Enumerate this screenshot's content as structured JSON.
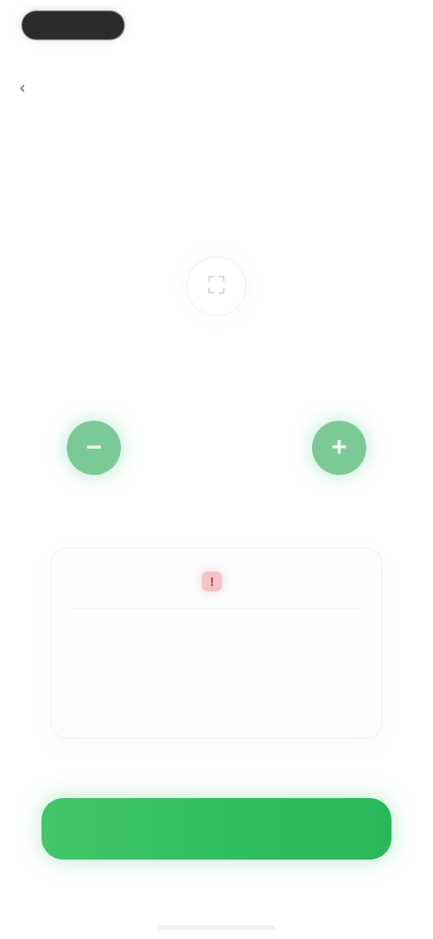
{
  "header": {
    "back_icon": "chevron-left-icon",
    "title": "",
    "subtitle": ""
  },
  "content": {
    "center_icon": "placeholder-icon",
    "card_title": "",
    "stepper": {
      "minus_label": "−",
      "value": "",
      "plus_label": "+",
      "hint": ""
    },
    "info": {
      "warning_icon": "warning-icon",
      "warning_title": "",
      "text_prefix": "",
      "text_emphasis": "",
      "text_suffix": "",
      "footnote": ""
    }
  },
  "actions": {
    "primary_label": ""
  },
  "colors": {
    "accent_green": "#2fbe60",
    "warning_red": "#c03b49"
  }
}
